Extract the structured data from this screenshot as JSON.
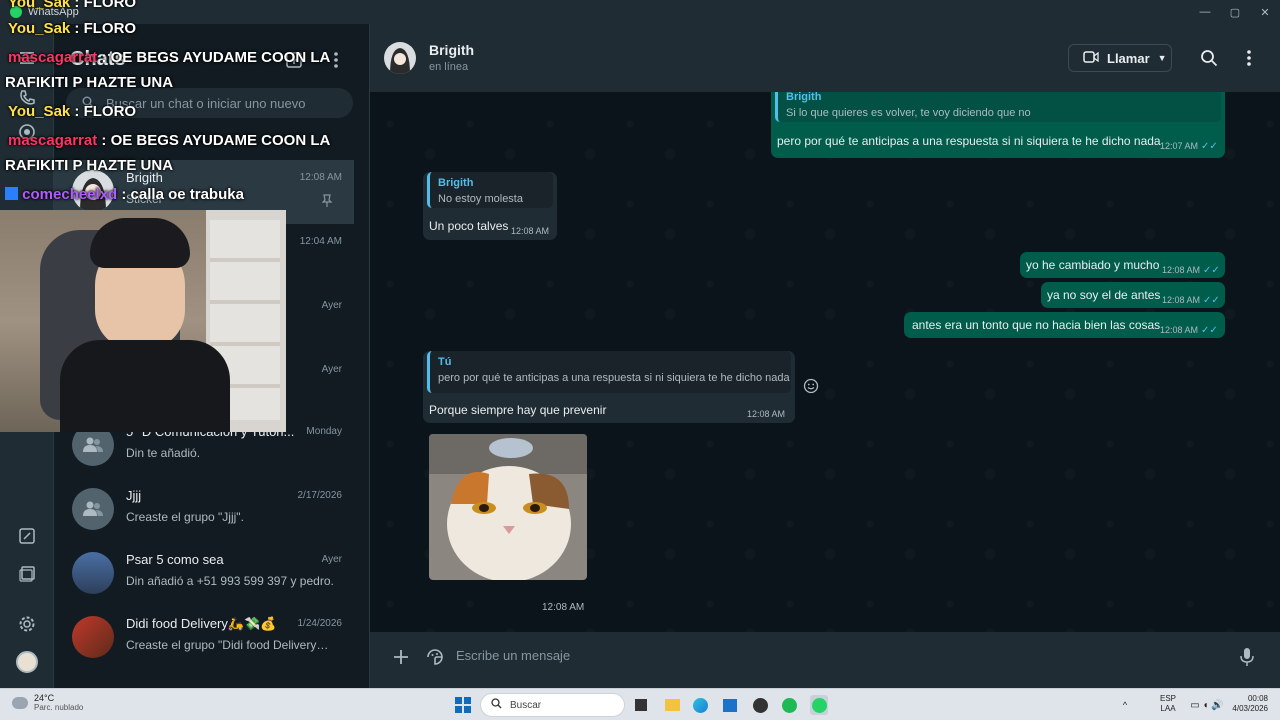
{
  "titlebar": {
    "app_name": "WhatsApp",
    "minimize": "—",
    "maximize": "▢",
    "close": "✕"
  },
  "sidebar": {
    "title": "Chats",
    "search_placeholder": "Buscar un chat o iniciar uno nuevo",
    "chats": [
      {
        "name": "Brigith",
        "preview": "Sticker",
        "time": "12:08 AM"
      },
      {
        "name": "",
        "preview": "",
        "time": "12:04 AM"
      },
      {
        "name": "",
        "preview": "",
        "time": "Ayer"
      },
      {
        "name": "",
        "preview": "",
        "time": "Ayer"
      },
      {
        "name": "5* D Comunicación y Tutori...",
        "preview": "Din te añadió.",
        "time": "Monday"
      },
      {
        "name": "Jjjj",
        "preview": "Creaste el grupo \"Jjjj\".",
        "time": "2/17/2026"
      },
      {
        "name": "Psar 5 como sea",
        "preview": "Din añadió a +51 993 599 397 y pedro.",
        "time": "Ayer"
      },
      {
        "name": "Didi food Delivery🛵💸💰",
        "preview": "Creaste el grupo \"Didi food Delivery🛵...",
        "time": "1/24/2026"
      }
    ]
  },
  "stream_chat": [
    {
      "user": "You_Sak",
      "text": ": FLORO"
    },
    {
      "user": "mascagarrat",
      "text": ": OE BEGS AYUDAME COON LA"
    },
    {
      "user": "",
      "text": "RAFIKITI P HAZTE UNA"
    },
    {
      "user": "You_Sak",
      "text": ": FLORO"
    },
    {
      "user": "mascagarrat",
      "text": ": OE BEGS AYUDAME COON LA"
    },
    {
      "user": "",
      "text": "RAFIKITI P HAZTE UNA"
    },
    {
      "user": "comecheelxd",
      "text": ": calla oe trabuka"
    }
  ],
  "chat": {
    "contact_name": "Brigith",
    "status": "en línea",
    "call_label": "Llamar",
    "messages": [
      {
        "dir": "out",
        "quote_name": "Brigith",
        "quote_text": "Si lo que quieres es volver, te voy diciendo que no",
        "text": "pero por qué te anticipas a una respuesta si ni siquiera te he dicho nada",
        "time": "12:07 AM"
      },
      {
        "dir": "in",
        "quote_name": "Brigith",
        "quote_text": "No estoy molesta",
        "text": "Un poco talves",
        "time": "12:08 AM"
      },
      {
        "dir": "out",
        "text": "yo he cambiado y mucho",
        "time": "12:08 AM"
      },
      {
        "dir": "out",
        "text": "ya no soy el de antes",
        "time": "12:08 AM"
      },
      {
        "dir": "out",
        "text": "antes era un tonto que no hacia bien las cosas",
        "time": "12:08 AM"
      },
      {
        "dir": "in",
        "quote_name": "Tú",
        "quote_text": "pero por qué te anticipas a una respuesta si ni siquiera te he dicho nada",
        "text": "Porque siempre hay que prevenir",
        "time": "12:08 AM"
      },
      {
        "dir": "in",
        "sticker": true,
        "time": "12:08 AM"
      }
    ],
    "composer_placeholder": "Escribe un mensaje"
  },
  "taskbar": {
    "weather_temp": "24°C",
    "weather_desc": "Parc. nublado",
    "search_label": "Buscar",
    "lang_top": "ESP",
    "lang_bottom": "LAA",
    "clock_time": "00:08",
    "clock_date": "4/03/2026"
  },
  "colors": {
    "accent": "#00a884",
    "outgoing": "#005c4b",
    "incoming": "#202c33",
    "background": "#0b141a",
    "tick": "#53bdeb"
  }
}
